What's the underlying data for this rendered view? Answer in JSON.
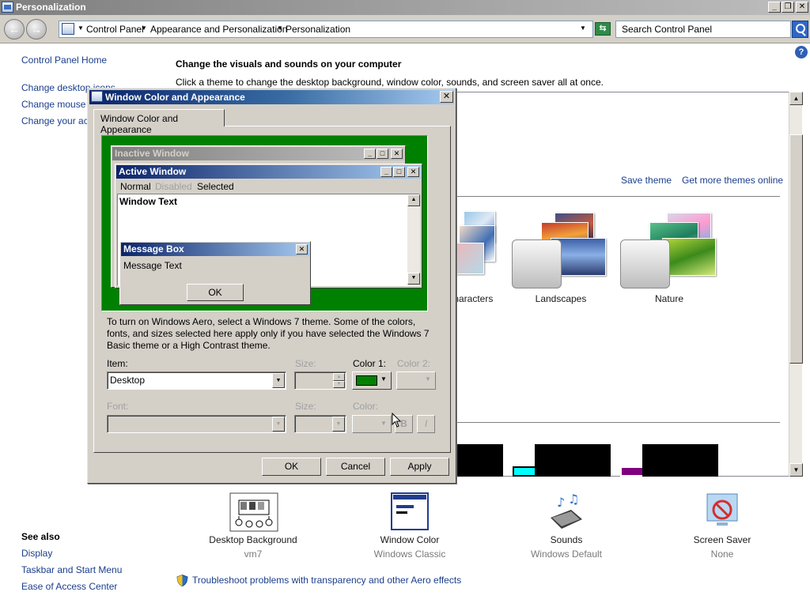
{
  "window": {
    "title": "Personalization"
  },
  "address_bar": {
    "crumbs": [
      "Control Panel",
      "Appearance and Personalization",
      "Personalization"
    ],
    "search_placeholder": "Search Control Panel"
  },
  "left_nav": {
    "home": "Control Panel Home",
    "links": [
      "Change desktop icons",
      "Change mouse pointers",
      "Change your account picture"
    ],
    "see_also_heading": "See also",
    "see_also": [
      "Display",
      "Taskbar and Start Menu",
      "Ease of Access Center"
    ]
  },
  "main": {
    "heading": "Change the visuals and sounds on your computer",
    "subheading": "Click a theme to change the desktop background, window color, sounds, and screen saver all at once.",
    "save_theme": "Save theme",
    "get_more_themes": "Get more themes online",
    "themes": [
      {
        "label": "Characters"
      },
      {
        "label": "Landscapes"
      },
      {
        "label": "Nature"
      }
    ],
    "bottom_icons": [
      {
        "label": "Desktop Background",
        "sub": "vm7"
      },
      {
        "label": "Window Color",
        "sub": "Windows Classic"
      },
      {
        "label": "Sounds",
        "sub": "Windows Default"
      },
      {
        "label": "Screen Saver",
        "sub": "None"
      }
    ],
    "troubleshoot": "Troubleshoot problems with transparency and other Aero effects"
  },
  "dialog": {
    "title": "Window Color and Appearance",
    "tab": "Window Color and Appearance",
    "preview": {
      "inactive_title": "Inactive Window",
      "active_title": "Active Window",
      "menu": [
        "Normal",
        "Disabled",
        "Selected"
      ],
      "window_text": "Window Text",
      "msgbox_title": "Message Box",
      "msgbox_text": "Message Text",
      "msgbox_ok": "OK",
      "desktop_color": "#008000"
    },
    "info": "To turn on Windows Aero, select a Windows 7 theme.  Some of the colors, fonts, and sizes selected here apply only if you have selected the Windows 7 Basic theme or a High Contrast theme.",
    "labels": {
      "item": "Item:",
      "size": "Size:",
      "color1": "Color 1:",
      "color2": "Color 2:",
      "font": "Font:",
      "size2": "Size:",
      "color": "Color:"
    },
    "item_value": "Desktop",
    "color1_value": "#008000",
    "bold_label": "B",
    "italic_label": "I",
    "buttons": {
      "ok": "OK",
      "cancel": "Cancel",
      "apply": "Apply"
    }
  }
}
